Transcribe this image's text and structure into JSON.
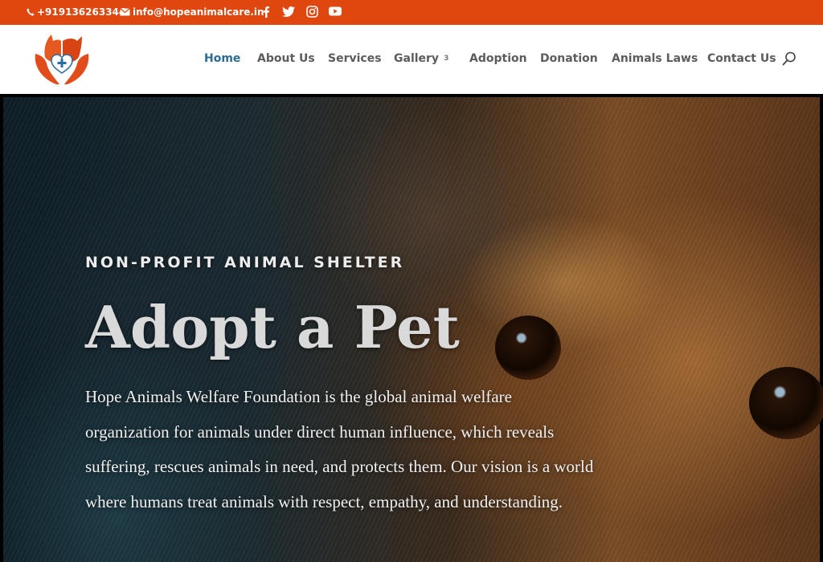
{
  "topbar": {
    "phone": "+919136263344",
    "email": "info@hopeanimalcare.in",
    "social": [
      "facebook-icon",
      "twitter-icon",
      "instagram-icon",
      "youtube-icon"
    ],
    "color": "#e0470f"
  },
  "nav": {
    "items": [
      {
        "label": "Home",
        "active": true
      },
      {
        "label": "About Us"
      },
      {
        "label": "Services"
      },
      {
        "label": "Gallery",
        "has_dropdown": true
      },
      {
        "label": "Adoption"
      },
      {
        "label": "Donation"
      },
      {
        "label": "Animals Laws"
      },
      {
        "label": "Contact Us"
      }
    ],
    "active_color": "#2b6d94",
    "dropdown_glyph": "3"
  },
  "hero": {
    "kicker": "NON-PROFIT ANIMAL SHELTER",
    "title": "Adopt a Pet",
    "body": "Hope Animals Welfare Foundation is the global animal welfare organization for animals under direct human influence, which reveals suffering, rescues animals in need, and protects them. Our vision is a world where humans treat animals with respect, empathy, and understanding."
  }
}
